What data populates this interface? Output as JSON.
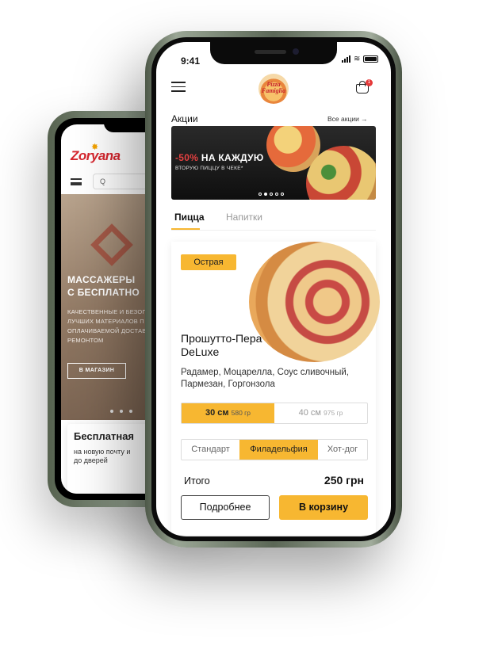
{
  "back_phone": {
    "logo_text": "Zoryana",
    "search_placeholder": "Q",
    "hero": {
      "title_line1": "МАССАЖЕРЫ",
      "title_line2": "С БЕСПЛАТНО",
      "subtitle": "КАЧЕСТВЕННЫЕ И БЕЗОП ЛУЧШИХ МАТЕРИАЛОВ П ОПЛАЧИВАЕМОЙ ДОСТАВ РЕМОНТОМ",
      "button": "В МАГАЗИН"
    },
    "card": {
      "title": "Бесплатная",
      "subtitle": "на новую почту и до дверей"
    }
  },
  "status_bar": {
    "time": "9:41"
  },
  "header": {
    "logo_text": "Pizza Famiglia",
    "cart_count": "1"
  },
  "promo": {
    "title": "Акции",
    "all_link": "Все акции →",
    "banner_highlight": "-50%",
    "banner_headline": " НА КАЖДУЮ",
    "banner_subline": "ВТОРУЮ ПИЦЦУ В ЧЕКЕ*",
    "slides": 5,
    "active_slide": 2
  },
  "tabs": [
    {
      "label": "Пицца",
      "active": true
    },
    {
      "label": "Напитки",
      "active": false
    }
  ],
  "product": {
    "tag": "Острая",
    "name": "Прошутто-Пера DeLuxe",
    "description": "Радамер, Моцарелла, Соус сливочный, Пармезан, Горгонзола",
    "sizes": [
      {
        "size": "30 см",
        "weight": "580 гр",
        "selected": true
      },
      {
        "size": "40 см",
        "weight": "975 гр",
        "selected": false
      }
    ],
    "crusts": [
      {
        "label": "Стандарт",
        "selected": false
      },
      {
        "label": "Филадельфия",
        "selected": true
      },
      {
        "label": "Хот-дог",
        "selected": false
      }
    ],
    "total_label": "Итого",
    "total_value": "250 грн",
    "more_button": "Подробнее",
    "cart_button": "В корзину"
  },
  "colors": {
    "accent": "#f7b731",
    "badge": "#e53a3a",
    "brand_red": "#d6262e"
  }
}
